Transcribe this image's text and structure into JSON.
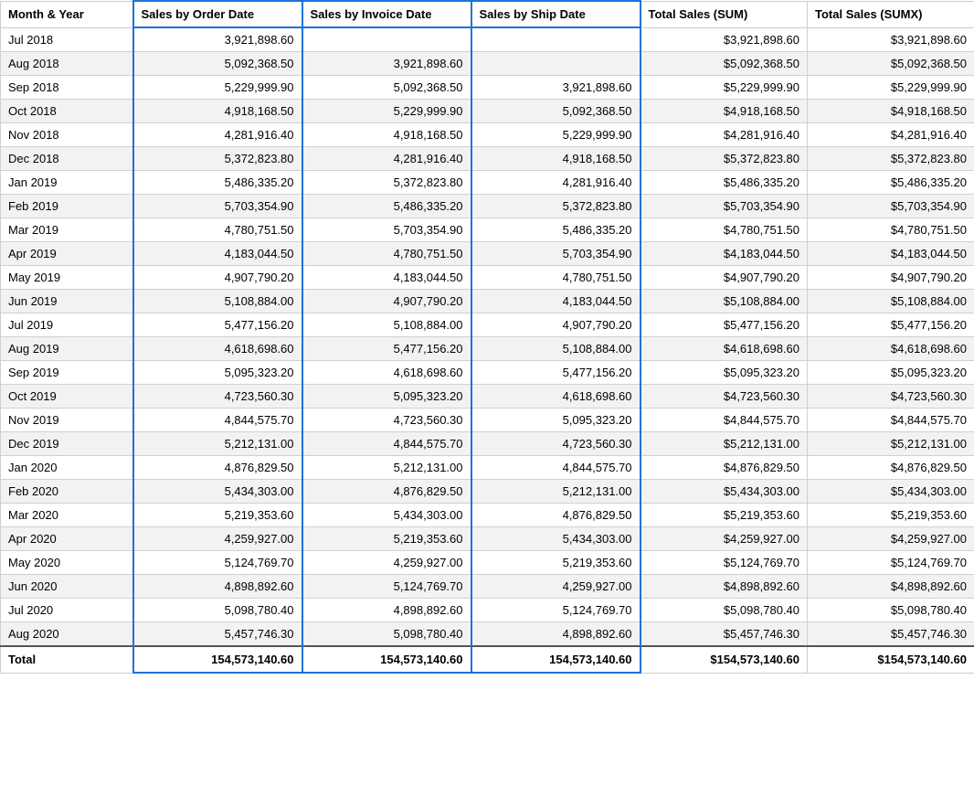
{
  "columns": [
    {
      "key": "month",
      "label": "Month & Year",
      "highlighted": false
    },
    {
      "key": "order",
      "label": "Sales by Order Date",
      "highlighted": true
    },
    {
      "key": "invoice",
      "label": "Sales by Invoice Date",
      "highlighted": true
    },
    {
      "key": "ship",
      "label": "Sales by Ship Date",
      "highlighted": true
    },
    {
      "key": "sum",
      "label": "Total Sales (SUM)",
      "highlighted": false
    },
    {
      "key": "sumx",
      "label": "Total Sales (SUMX)",
      "highlighted": false
    }
  ],
  "rows": [
    {
      "month": "Jul 2018",
      "order": "3,921,898.60",
      "invoice": "",
      "ship": "",
      "sum": "$3,921,898.60",
      "sumx": "$3,921,898.60"
    },
    {
      "month": "Aug 2018",
      "order": "5,092,368.50",
      "invoice": "3,921,898.60",
      "ship": "",
      "sum": "$5,092,368.50",
      "sumx": "$5,092,368.50"
    },
    {
      "month": "Sep 2018",
      "order": "5,229,999.90",
      "invoice": "5,092,368.50",
      "ship": "3,921,898.60",
      "sum": "$5,229,999.90",
      "sumx": "$5,229,999.90"
    },
    {
      "month": "Oct 2018",
      "order": "4,918,168.50",
      "invoice": "5,229,999.90",
      "ship": "5,092,368.50",
      "sum": "$4,918,168.50",
      "sumx": "$4,918,168.50"
    },
    {
      "month": "Nov 2018",
      "order": "4,281,916.40",
      "invoice": "4,918,168.50",
      "ship": "5,229,999.90",
      "sum": "$4,281,916.40",
      "sumx": "$4,281,916.40"
    },
    {
      "month": "Dec 2018",
      "order": "5,372,823.80",
      "invoice": "4,281,916.40",
      "ship": "4,918,168.50",
      "sum": "$5,372,823.80",
      "sumx": "$5,372,823.80"
    },
    {
      "month": "Jan 2019",
      "order": "5,486,335.20",
      "invoice": "5,372,823.80",
      "ship": "4,281,916.40",
      "sum": "$5,486,335.20",
      "sumx": "$5,486,335.20"
    },
    {
      "month": "Feb 2019",
      "order": "5,703,354.90",
      "invoice": "5,486,335.20",
      "ship": "5,372,823.80",
      "sum": "$5,703,354.90",
      "sumx": "$5,703,354.90"
    },
    {
      "month": "Mar 2019",
      "order": "4,780,751.50",
      "invoice": "5,703,354.90",
      "ship": "5,486,335.20",
      "sum": "$4,780,751.50",
      "sumx": "$4,780,751.50"
    },
    {
      "month": "Apr 2019",
      "order": "4,183,044.50",
      "invoice": "4,780,751.50",
      "ship": "5,703,354.90",
      "sum": "$4,183,044.50",
      "sumx": "$4,183,044.50"
    },
    {
      "month": "May 2019",
      "order": "4,907,790.20",
      "invoice": "4,183,044.50",
      "ship": "4,780,751.50",
      "sum": "$4,907,790.20",
      "sumx": "$4,907,790.20"
    },
    {
      "month": "Jun 2019",
      "order": "5,108,884.00",
      "invoice": "4,907,790.20",
      "ship": "4,183,044.50",
      "sum": "$5,108,884.00",
      "sumx": "$5,108,884.00"
    },
    {
      "month": "Jul 2019",
      "order": "5,477,156.20",
      "invoice": "5,108,884.00",
      "ship": "4,907,790.20",
      "sum": "$5,477,156.20",
      "sumx": "$5,477,156.20"
    },
    {
      "month": "Aug 2019",
      "order": "4,618,698.60",
      "invoice": "5,477,156.20",
      "ship": "5,108,884.00",
      "sum": "$4,618,698.60",
      "sumx": "$4,618,698.60"
    },
    {
      "month": "Sep 2019",
      "order": "5,095,323.20",
      "invoice": "4,618,698.60",
      "ship": "5,477,156.20",
      "sum": "$5,095,323.20",
      "sumx": "$5,095,323.20"
    },
    {
      "month": "Oct 2019",
      "order": "4,723,560.30",
      "invoice": "5,095,323.20",
      "ship": "4,618,698.60",
      "sum": "$4,723,560.30",
      "sumx": "$4,723,560.30"
    },
    {
      "month": "Nov 2019",
      "order": "4,844,575.70",
      "invoice": "4,723,560.30",
      "ship": "5,095,323.20",
      "sum": "$4,844,575.70",
      "sumx": "$4,844,575.70"
    },
    {
      "month": "Dec 2019",
      "order": "5,212,131.00",
      "invoice": "4,844,575.70",
      "ship": "4,723,560.30",
      "sum": "$5,212,131.00",
      "sumx": "$5,212,131.00"
    },
    {
      "month": "Jan 2020",
      "order": "4,876,829.50",
      "invoice": "5,212,131.00",
      "ship": "4,844,575.70",
      "sum": "$4,876,829.50",
      "sumx": "$4,876,829.50"
    },
    {
      "month": "Feb 2020",
      "order": "5,434,303.00",
      "invoice": "4,876,829.50",
      "ship": "5,212,131.00",
      "sum": "$5,434,303.00",
      "sumx": "$5,434,303.00"
    },
    {
      "month": "Mar 2020",
      "order": "5,219,353.60",
      "invoice": "5,434,303.00",
      "ship": "4,876,829.50",
      "sum": "$5,219,353.60",
      "sumx": "$5,219,353.60"
    },
    {
      "month": "Apr 2020",
      "order": "4,259,927.00",
      "invoice": "5,219,353.60",
      "ship": "5,434,303.00",
      "sum": "$4,259,927.00",
      "sumx": "$4,259,927.00"
    },
    {
      "month": "May 2020",
      "order": "5,124,769.70",
      "invoice": "4,259,927.00",
      "ship": "5,219,353.60",
      "sum": "$5,124,769.70",
      "sumx": "$5,124,769.70"
    },
    {
      "month": "Jun 2020",
      "order": "4,898,892.60",
      "invoice": "5,124,769.70",
      "ship": "4,259,927.00",
      "sum": "$4,898,892.60",
      "sumx": "$4,898,892.60"
    },
    {
      "month": "Jul 2020",
      "order": "5,098,780.40",
      "invoice": "4,898,892.60",
      "ship": "5,124,769.70",
      "sum": "$5,098,780.40",
      "sumx": "$5,098,780.40"
    },
    {
      "month": "Aug 2020",
      "order": "5,457,746.30",
      "invoice": "5,098,780.40",
      "ship": "4,898,892.60",
      "sum": "$5,457,746.30",
      "sumx": "$5,457,746.30"
    }
  ],
  "totals": {
    "month": "Total",
    "order": "154,573,140.60",
    "invoice": "154,573,140.60",
    "ship": "154,573,140.60",
    "sum": "$154,573,140.60",
    "sumx": "$154,573,140.60"
  }
}
